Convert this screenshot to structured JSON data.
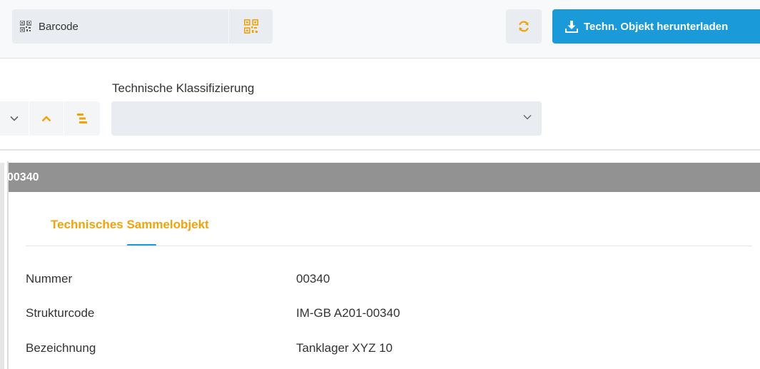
{
  "toolbar": {
    "barcode_placeholder": "Barcode",
    "download_label": "Techn. Objekt herunterladen"
  },
  "filter": {
    "label": "Technische Klassifizierung",
    "selected_value": ""
  },
  "panel": {
    "title": "00340",
    "tab_label": "Technisches Sammelobjekt",
    "properties": [
      {
        "label": "Nummer",
        "value": "00340"
      },
      {
        "label": "Strukturcode",
        "value": "IM-GB A201-00340"
      },
      {
        "label": "Bezeichnung",
        "value": "Tanklager XYZ 10"
      }
    ]
  },
  "colors": {
    "accent_blue": "#1a9ad9",
    "accent_orange": "#f0a30a",
    "header_gray": "#929292"
  },
  "icons": [
    "qr-code-icon",
    "refresh-icon",
    "download-icon",
    "chevron-down-icon",
    "chevron-up-icon",
    "tree-icon"
  ]
}
